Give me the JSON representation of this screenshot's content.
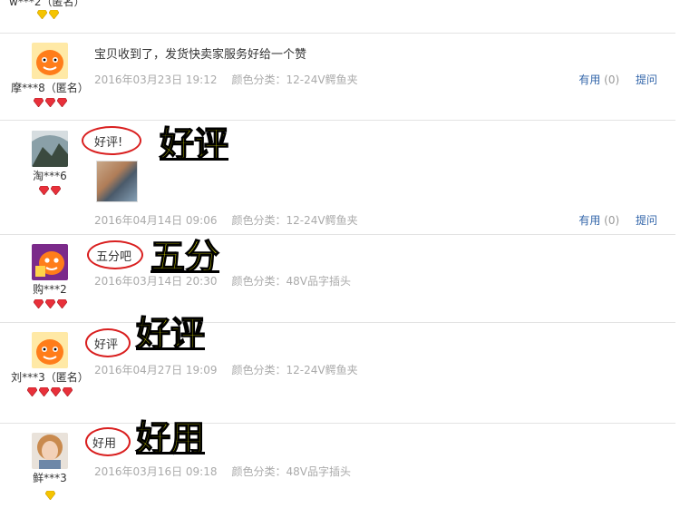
{
  "colors": {
    "brand_orange": "#ff7d1a",
    "gem_red": "#e8303a",
    "gem_gold": "#f5c400",
    "link_blue": "#3366aa",
    "annotation_red": "#d91f1f",
    "annotation_yellow": "#ffff00"
  },
  "top_fragment": {
    "user": "w***2（匿名）"
  },
  "reviews": [
    {
      "user": "摩***8（匿名）",
      "avatar_icon": "taobao-orange-mascot-icon",
      "gem_count": 3,
      "gem_color": "red",
      "content": "宝贝收到了，发货快卖家服务好给一个赞",
      "date": "2016年03月23日 19:12",
      "sku": "颜色分类：12-24V鳄鱼夹",
      "useful_label": "有用",
      "useful_count": "(0)",
      "reply_label": "提问"
    },
    {
      "user": "淘***6",
      "avatar_icon": "photo-avatar-icon",
      "gem_count": 2,
      "gem_color": "red",
      "content": "好评!",
      "annotation": "好评",
      "date": "2016年04月14日 09:06",
      "sku": "颜色分类：12-24V鳄鱼夹",
      "useful_label": "有用",
      "useful_count": "(0)",
      "reply_label": "提问"
    },
    {
      "user": "购***2",
      "avatar_icon": "taobao-mascot-purple-icon",
      "gem_count": 3,
      "gem_color": "red",
      "content": "五分吧",
      "annotation": "五分",
      "date": "2016年03月14日 20:30",
      "sku": "颜色分类：48V品字插头"
    },
    {
      "user": "刘***3（匿名）",
      "avatar_icon": "taobao-orange-mascot-icon",
      "gem_count": 4,
      "gem_color": "red",
      "content": "好评",
      "annotation": "好评",
      "date": "2016年04月27日 19:09",
      "sku": "颜色分类：12-24V鳄鱼夹"
    },
    {
      "user": "鲜***3",
      "avatar_icon": "girl-photo-avatar-icon",
      "gem_count": 1,
      "gem_color": "gold",
      "content": "好用",
      "annotation": "好用",
      "date": "2016年03月16日 09:18",
      "sku": "颜色分类：48V品字插头"
    }
  ]
}
